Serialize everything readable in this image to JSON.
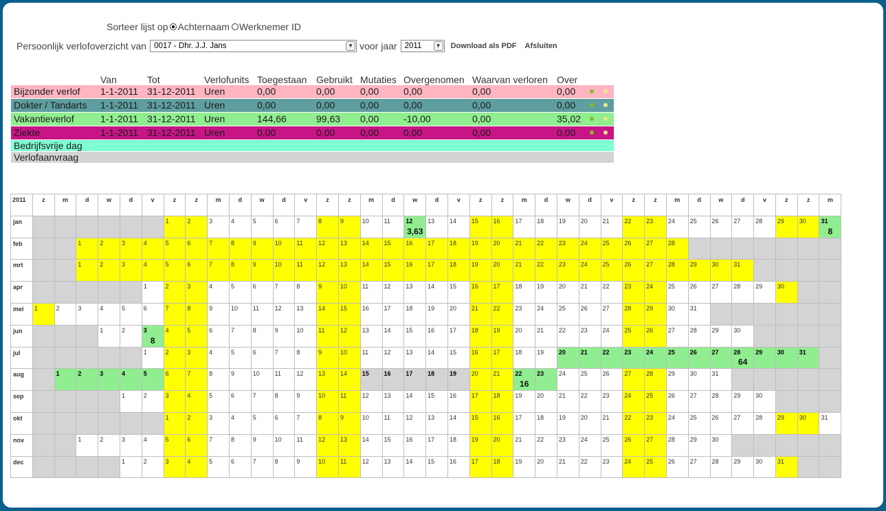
{
  "sort": {
    "label": "Sorteer lijst op",
    "option1": "Achternaam",
    "option2": "Werknemer ID"
  },
  "controls": {
    "label": "Persoonlijk verlofoverzicht van",
    "employee": "0017 - Dhr. J.J. Jans",
    "year_label": "voor jaar",
    "year": "2011",
    "pdf": "Download als PDF",
    "close": "Afsluiten"
  },
  "leave_table": {
    "headers": [
      "Van",
      "Tot",
      "Verlofunits",
      "Toegestaan",
      "Gebruikt",
      "Mutaties",
      "Overgenomen",
      "Waarvan verloren",
      "Over"
    ],
    "rows": [
      {
        "name": "Bijzonder verlof",
        "van": "1-1-2011",
        "tot": "31-12-2011",
        "units": "Uren",
        "toegestaan": "0,00",
        "gebruikt": "0,00",
        "mutaties": "0,00",
        "overgenomen": "0,00",
        "verloren": "0,00",
        "over": "0,00",
        "color": "#ffb6c1"
      },
      {
        "name": "Dokter / Tandarts",
        "van": "1-1-2011",
        "tot": "31-12-2011",
        "units": "Uren",
        "toegestaan": "0,00",
        "gebruikt": "0,00",
        "mutaties": "0,00",
        "overgenomen": "0,00",
        "verloren": "0,00",
        "over": "0,00",
        "color": "#5f9ea0"
      },
      {
        "name": "Vakantieverlof",
        "van": "1-1-2011",
        "tot": "31-12-2011",
        "units": "Uren",
        "toegestaan": "144,66",
        "gebruikt": "99,63",
        "mutaties": "0,00",
        "overgenomen": "-10,00",
        "verloren": "0,00",
        "over": "35,02",
        "color": "#90ee90"
      },
      {
        "name": "Ziekte",
        "van": "1-1-2011",
        "tot": "31-12-2011",
        "units": "Uren",
        "toegestaan": "0,00",
        "gebruikt": "0,00",
        "mutaties": "0,00",
        "overgenomen": "0,00",
        "verloren": "0,00",
        "over": "0,00",
        "color": "#c71585"
      }
    ],
    "legend": [
      {
        "name": "Bedrijfsvrije dag",
        "color": "#7fffd4"
      },
      {
        "name": "Verlofaanvraag",
        "color": "#d3d3d3"
      }
    ],
    "dot_colors": {
      "green": "#80c020",
      "yellow": "#f0e68c"
    }
  },
  "calendar": {
    "year": "2011",
    "weekdays": [
      "z",
      "m",
      "d",
      "w",
      "d",
      "v",
      "z",
      "z",
      "m",
      "d",
      "w",
      "d",
      "v",
      "z",
      "z",
      "m",
      "d",
      "w",
      "d",
      "v",
      "z",
      "z",
      "m",
      "d",
      "w",
      "d",
      "v",
      "z",
      "z",
      "m",
      "d",
      "w",
      "d",
      "v",
      "z",
      "z",
      "m"
    ],
    "months": [
      {
        "name": "jan",
        "start": 6,
        "days": 31
      },
      {
        "name": "feb",
        "start": 2,
        "days": 28
      },
      {
        "name": "mrt",
        "start": 2,
        "days": 31
      },
      {
        "name": "apr",
        "start": 5,
        "days": 30
      },
      {
        "name": "mei",
        "start": 0,
        "days": 31
      },
      {
        "name": "jun",
        "start": 3,
        "days": 30
      },
      {
        "name": "jul",
        "start": 5,
        "days": 31
      },
      {
        "name": "aug",
        "start": 1,
        "days": 31
      },
      {
        "name": "sep",
        "start": 4,
        "days": 30
      },
      {
        "name": "okt",
        "start": 6,
        "days": 31
      },
      {
        "name": "nov",
        "start": 2,
        "days": 30
      },
      {
        "name": "dec",
        "start": 4,
        "days": 31
      }
    ],
    "colors": {
      "weekend": "#ffff00",
      "leave": "#90ee90",
      "request": "#d4d4d4",
      "empty": "#d4d4d4"
    },
    "leave": [
      {
        "month": "jan",
        "days": [
          12
        ],
        "hours": "3,63"
      },
      {
        "month": "jan",
        "days": [
          31
        ],
        "hours": "8"
      },
      {
        "month": "jun",
        "days": [
          3
        ],
        "hours": "8"
      },
      {
        "month": "jul",
        "days": [
          20,
          21,
          22,
          23,
          24,
          25,
          26,
          27,
          28,
          29,
          30,
          31
        ],
        "hours": "64"
      },
      {
        "month": "aug",
        "days": [
          1,
          2,
          3,
          4,
          5
        ],
        "hours": ""
      },
      {
        "month": "aug",
        "days": [
          22,
          23
        ],
        "hours": "16"
      }
    ],
    "requests": [
      {
        "month": "aug",
        "days": [
          15,
          16,
          17,
          18,
          19
        ]
      }
    ],
    "weekend_overrides": [
      {
        "month": "feb",
        "days": [
          1,
          2,
          3,
          4,
          7,
          8,
          9,
          10,
          11,
          14,
          15,
          16,
          17,
          18,
          21,
          22,
          23,
          24,
          25,
          28
        ]
      },
      {
        "month": "mrt",
        "days": [
          1,
          2,
          3,
          4,
          7,
          8,
          9,
          10,
          11,
          14,
          15,
          16,
          17,
          18,
          21,
          22,
          23,
          24,
          25,
          28,
          29,
          30,
          31
        ]
      }
    ]
  }
}
